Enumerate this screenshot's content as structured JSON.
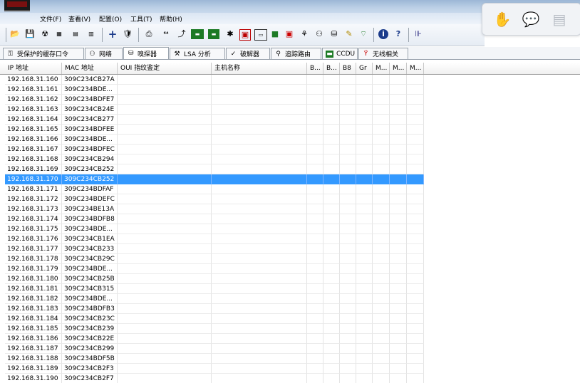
{
  "menu": [
    "文件(F)",
    "查看(V)",
    "配置(O)",
    "工具(T)",
    "帮助(H)"
  ],
  "toolbar_icons": [
    "open-icon",
    "save-icon",
    "radiation-icon",
    "ip-list-icon",
    "hex-icon",
    "bin-icon",
    "add-icon",
    "shield-icon",
    "print-icon",
    "b64-icon",
    "route-icon",
    "network-card-icon",
    "ip-card-icon",
    "antenna-icon",
    "scan-icon",
    "terminal-icon",
    "monitor-icon",
    "record-icon",
    "tree-icon",
    "users-icon",
    "packet-icon",
    "note-icon",
    "wifi-icon",
    "info-icon",
    "help-icon",
    "chart-icon"
  ],
  "tabs": [
    {
      "label": "受保护的缓存口令",
      "icon": "key-icon"
    },
    {
      "label": "网络",
      "icon": "network-icon"
    },
    {
      "label": "嗅探器",
      "icon": "sniffer-icon"
    },
    {
      "label": "LSA 分析",
      "icon": "lsa-icon"
    },
    {
      "label": "破解器",
      "icon": "cracker-icon"
    },
    {
      "label": "追踪路由",
      "icon": "traceroute-icon"
    },
    {
      "label": "CCDU",
      "icon": "ccdu-icon"
    },
    {
      "label": "无线相关",
      "icon": "wireless-icon"
    }
  ],
  "active_tab": 2,
  "columns": [
    "IP 地址",
    "MAC 地址",
    "OUI 指纹鉴定",
    "主机名称",
    "B...",
    "B...",
    "B8",
    "Gr",
    "M...",
    "M...",
    "M..."
  ],
  "rows": [
    {
      "ip": "192.168.31.160",
      "mac": "309C234CB27A"
    },
    {
      "ip": "192.168.31.161",
      "mac": "309C234BDE..."
    },
    {
      "ip": "192.168.31.162",
      "mac": "309C234BDFE7"
    },
    {
      "ip": "192.168.31.163",
      "mac": "309C234CB24E"
    },
    {
      "ip": "192.168.31.164",
      "mac": "309C234CB277"
    },
    {
      "ip": "192.168.31.165",
      "mac": "309C234BDFEE"
    },
    {
      "ip": "192.168.31.166",
      "mac": "309C234BDE..."
    },
    {
      "ip": "192.168.31.167",
      "mac": "309C234BDFEC"
    },
    {
      "ip": "192.168.31.168",
      "mac": "309C234CB294"
    },
    {
      "ip": "192.168.31.169",
      "mac": "309C234CB252"
    },
    {
      "ip": "192.168.31.170",
      "mac": "309C234CB252",
      "selected": true
    },
    {
      "ip": "192.168.31.171",
      "mac": "309C234BDFAF"
    },
    {
      "ip": "192.168.31.172",
      "mac": "309C234BDEFC"
    },
    {
      "ip": "192.168.31.173",
      "mac": "309C234BE13A"
    },
    {
      "ip": "192.168.31.174",
      "mac": "309C234BDFB8"
    },
    {
      "ip": "192.168.31.175",
      "mac": "309C234BDE..."
    },
    {
      "ip": "192.168.31.176",
      "mac": "309C234CB1EA"
    },
    {
      "ip": "192.168.31.177",
      "mac": "309C234CB233"
    },
    {
      "ip": "192.168.31.178",
      "mac": "309C234CB29C"
    },
    {
      "ip": "192.168.31.179",
      "mac": "309C234BDE..."
    },
    {
      "ip": "192.168.31.180",
      "mac": "309C234CB25B"
    },
    {
      "ip": "192.168.31.181",
      "mac": "309C234CB315"
    },
    {
      "ip": "192.168.31.182",
      "mac": "309C234BDE..."
    },
    {
      "ip": "192.168.31.183",
      "mac": "309C234BDFB3"
    },
    {
      "ip": "192.168.31.184",
      "mac": "309C234CB23C"
    },
    {
      "ip": "192.168.31.185",
      "mac": "309C234CB239"
    },
    {
      "ip": "192.168.31.186",
      "mac": "309C234CB22E"
    },
    {
      "ip": "192.168.31.187",
      "mac": "309C234CB299"
    },
    {
      "ip": "192.168.31.188",
      "mac": "309C234BDF5B"
    },
    {
      "ip": "192.168.31.189",
      "mac": "309C234CB2F3"
    },
    {
      "ip": "192.168.31.190",
      "mac": "309C234CB2F7"
    }
  ],
  "colors": {
    "selection": "#3399ff",
    "grid": "#e4e4e4"
  }
}
